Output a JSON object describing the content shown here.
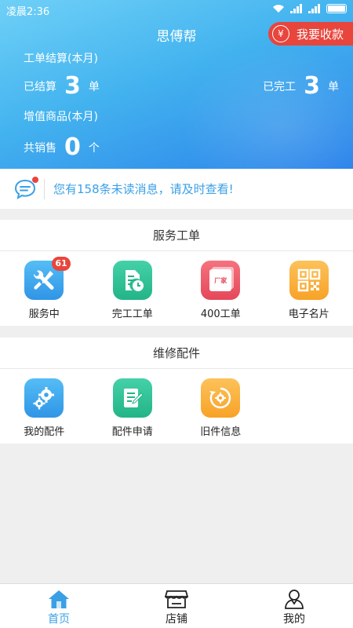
{
  "status_bar": {
    "time": "凌晨2:36"
  },
  "header": {
    "title": "思傅帮",
    "collect_button": {
      "icon_char": "¥",
      "label": "我要收款"
    },
    "workorder_section_label": "工单结算(本月)",
    "settled": {
      "label": "已结算",
      "value": "3",
      "unit": "单"
    },
    "completed": {
      "label": "已完工",
      "value": "3",
      "unit": "单"
    },
    "value_added_label": "增值商品(本月)",
    "sold": {
      "label": "共销售",
      "value": "0",
      "unit": "个"
    }
  },
  "notice": {
    "text": "您有158条未读消息，请及时查看!"
  },
  "service_section": {
    "title": "服务工单",
    "items": [
      {
        "label": "服务中",
        "badge": "61",
        "color": "#3aa5ee",
        "icon": "tools-icon"
      },
      {
        "label": "完工工单",
        "color": "#34c49a",
        "icon": "document-clock-icon"
      },
      {
        "label": "400工单",
        "color": "#ef5e6c",
        "icon": "factory-order-icon",
        "inner_text": "厂家"
      },
      {
        "label": "电子名片",
        "color": "#fbb03b",
        "icon": "qr-code-icon"
      }
    ]
  },
  "parts_section": {
    "title": "维修配件",
    "items": [
      {
        "label": "我的配件",
        "color": "#3aa5ee",
        "icon": "gears-icon"
      },
      {
        "label": "配件申请",
        "color": "#34c49a",
        "icon": "form-edit-icon"
      },
      {
        "label": "旧件信息",
        "color": "#fbb03b",
        "icon": "recycle-gear-icon"
      }
    ]
  },
  "tab_bar": {
    "tabs": [
      {
        "label": "首页",
        "icon": "home-icon",
        "active": true
      },
      {
        "label": "店铺",
        "icon": "store-icon",
        "active": false
      },
      {
        "label": "我的",
        "icon": "person-icon",
        "active": false
      }
    ]
  },
  "colors": {
    "accent": "#3aa0e6",
    "red": "#e8453c",
    "header_start": "#6fd0f7",
    "header_end": "#2b82ea"
  }
}
